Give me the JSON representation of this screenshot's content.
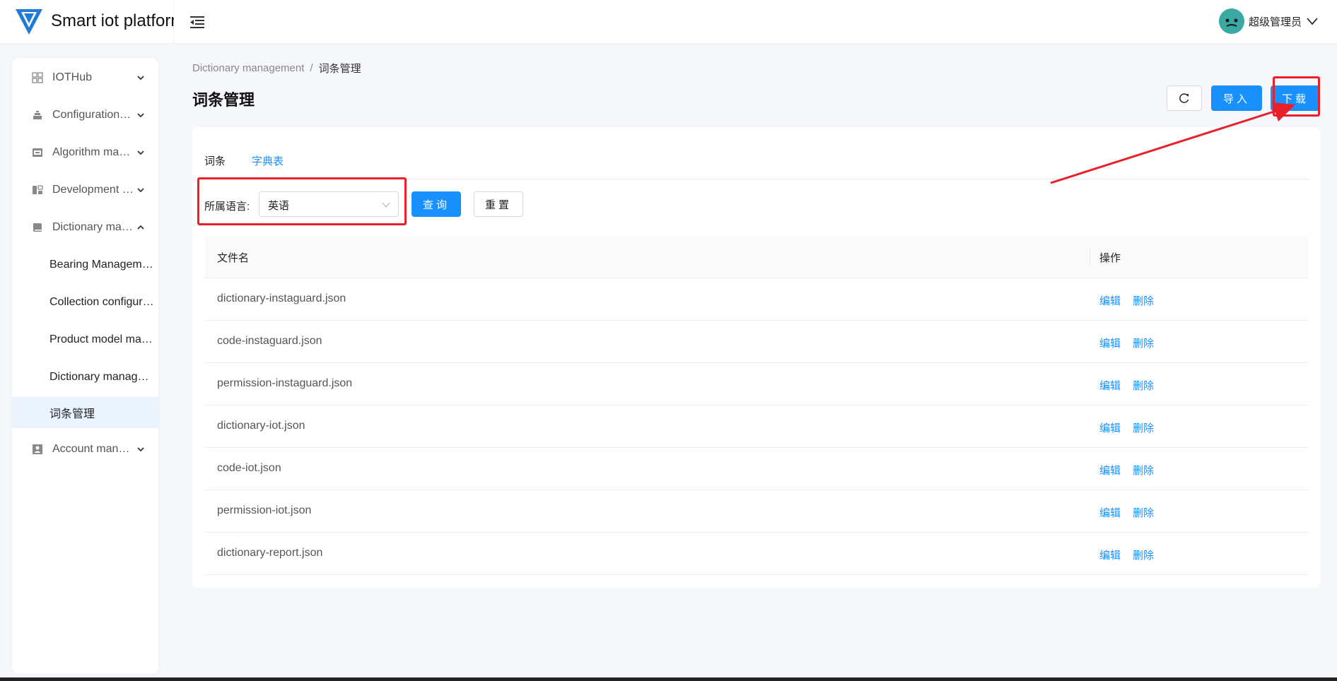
{
  "header": {
    "app_title": "Smart iot platform",
    "user_name": "超级管理员",
    "colors": {
      "logo": "#1f7bd6",
      "avatar": "#3aa9a3"
    }
  },
  "sidebar": {
    "items": [
      {
        "label": "IOTHub",
        "icon": "grid-icon",
        "expanded": false
      },
      {
        "label": "Configuration management",
        "icon": "stack-icon",
        "expanded": false
      },
      {
        "label": "Algorithm management",
        "icon": "algorithm-icon",
        "expanded": false
      },
      {
        "label": "Development management",
        "icon": "devices-icon",
        "expanded": false
      },
      {
        "label": "Dictionary management",
        "icon": "book-icon",
        "expanded": true
      },
      {
        "label": "Account management",
        "icon": "account-icon",
        "expanded": false
      }
    ],
    "sub_items": [
      {
        "label": "Bearing Management"
      },
      {
        "label": "Collection configuration"
      },
      {
        "label": "Product model management"
      },
      {
        "label": "Dictionary management"
      },
      {
        "label": "词条管理",
        "active": true
      }
    ]
  },
  "breadcrumb": {
    "parent": "Dictionary management",
    "separator": "/",
    "current": "词条管理"
  },
  "page": {
    "title": "词条管理"
  },
  "toolbar": {
    "import_label": "导入",
    "download_label": "下载"
  },
  "tabs": [
    {
      "label": "词条"
    },
    {
      "label": "字典表",
      "active": true
    }
  ],
  "filter": {
    "language_label": "所属语言:",
    "language_value": "英语",
    "query_label": "查询",
    "reset_label": "重置"
  },
  "table": {
    "columns": [
      "文件名",
      "操作"
    ],
    "rows": [
      {
        "name": "dictionary-instaguard.json",
        "edit": "编辑",
        "delete": "删除"
      },
      {
        "name": "code-instaguard.json",
        "edit": "编辑",
        "delete": "删除"
      },
      {
        "name": "permission-instaguard.json",
        "edit": "编辑",
        "delete": "删除"
      },
      {
        "name": "dictionary-iot.json",
        "edit": "编辑",
        "delete": "删除"
      },
      {
        "name": "code-iot.json",
        "edit": "编辑",
        "delete": "删除"
      },
      {
        "name": "permission-iot.json",
        "edit": "编辑",
        "delete": "删除"
      },
      {
        "name": "dictionary-report.json",
        "edit": "编辑",
        "delete": "删除"
      }
    ]
  },
  "accent_color": "#1890ff",
  "annotation_color": "#e8202a"
}
